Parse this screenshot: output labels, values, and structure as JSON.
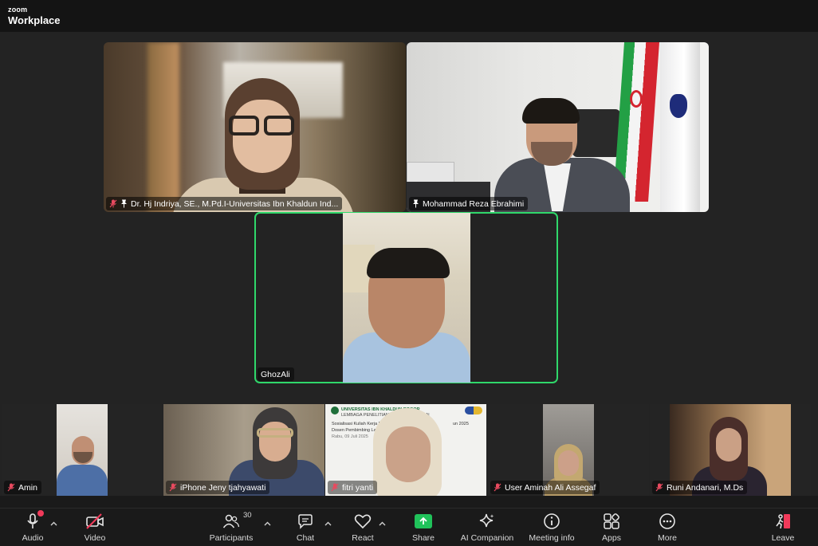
{
  "app": {
    "brand_top": "zoom",
    "brand_bottom": "Workplace"
  },
  "participants_main": [
    {
      "name": "Dr. Hj Indriya, SE., M.Pd.I-Universitas Ibn Khaldun Ind...",
      "muted": true,
      "pinned": true
    },
    {
      "name": "Mohammad Reza Ebrahimi",
      "muted": false,
      "pinned": true
    },
    {
      "name": "GhozAli",
      "muted": false,
      "pinned": false,
      "active_speaker": true
    }
  ],
  "participants_strip": [
    {
      "name": "Amin",
      "muted": true
    },
    {
      "name": "iPhone Jeny tjahyawati",
      "muted": true
    },
    {
      "name": "fitri yanti",
      "muted": true
    },
    {
      "name": "User Aminah Ali Assegaf",
      "muted": true
    },
    {
      "name": "Runi Andanari, M.Ds",
      "muted": true
    }
  ],
  "shared_slide": {
    "org_line1": "UNIVERSITAS IBN KHALDUN BOGOR",
    "org_line2": "LEMBAGA PENELITIAN DAN PENGABDIAN",
    "line1": "Sosialisasi Kuliah Kerja Nyata",
    "line1_suffix": "un 2025",
    "line2": "Dosen Pembimbing Lapang",
    "line3": "Rabu, 09 Juli 2025"
  },
  "toolbar": {
    "audio": "Audio",
    "video": "Video",
    "participants": "Participants",
    "participants_count": "30",
    "chat": "Chat",
    "react": "React",
    "share": "Share",
    "ai_companion": "AI Companion",
    "meeting_info": "Meeting info",
    "apps": "Apps",
    "more": "More",
    "leave": "Leave"
  },
  "colors": {
    "active_speaker_border": "#2fd86a",
    "share_green": "#20c25a",
    "muted_red": "#e84a5f",
    "leave_red": "#f13a5a"
  }
}
